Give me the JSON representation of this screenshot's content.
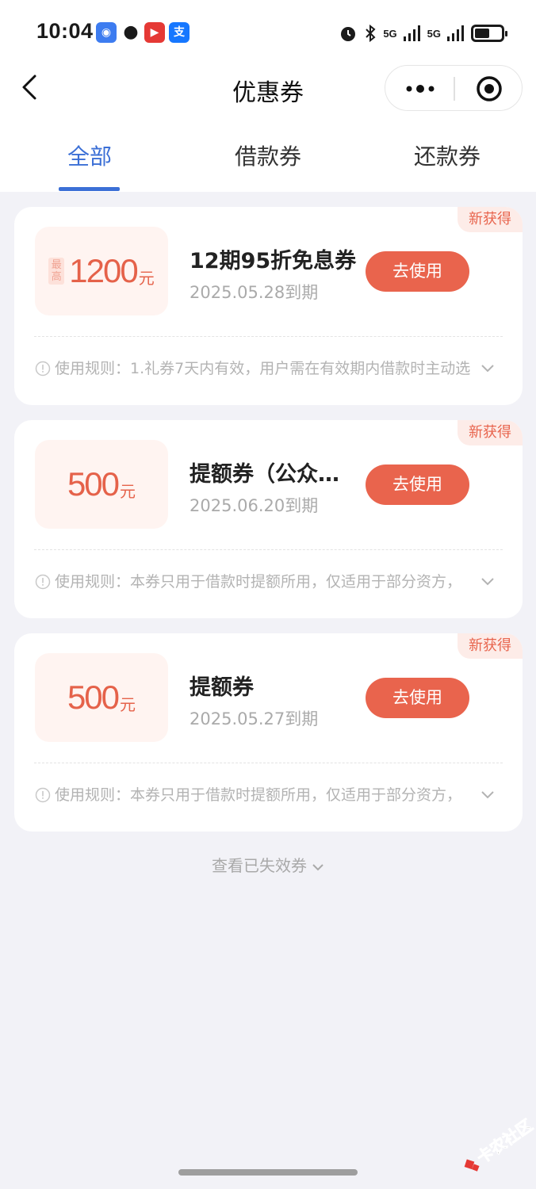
{
  "status_bar": {
    "time": "10:04",
    "signal_label_1": "5G",
    "signal_label_2": "5G"
  },
  "nav": {
    "title": "优惠券"
  },
  "tabs": [
    {
      "label": "全部",
      "active": true
    },
    {
      "label": "借款券",
      "active": false
    },
    {
      "label": "还款券",
      "active": false
    }
  ],
  "coupons": [
    {
      "badge": "新获得",
      "max_tag": "最高",
      "amount": "1200",
      "unit": "元",
      "title": "12期95折免息券",
      "expire": "2025.05.28到期",
      "button": "去使用",
      "rule": "使用规则：1.礼券7天内有效，用户需在有效期内借款时主动选"
    },
    {
      "badge": "新获得",
      "amount": "500",
      "unit": "元",
      "title": "提额券（公众…",
      "expire": "2025.06.20到期",
      "button": "去使用",
      "rule": "使用规则：本券只用于借款时提额所用，仅适用于部分资方，"
    },
    {
      "badge": "新获得",
      "amount": "500",
      "unit": "元",
      "title": "提额券",
      "expire": "2025.05.27到期",
      "button": "去使用",
      "rule": "使用规则：本券只用于借款时提额所用，仅适用于部分资方，"
    }
  ],
  "footer": {
    "view_expired": "查看已失效券"
  },
  "watermark": {
    "text": "卡农社区"
  },
  "colors": {
    "accent_blue": "#3b6fd6",
    "coupon_red": "#e9644d",
    "background": "#f2f2f7"
  }
}
